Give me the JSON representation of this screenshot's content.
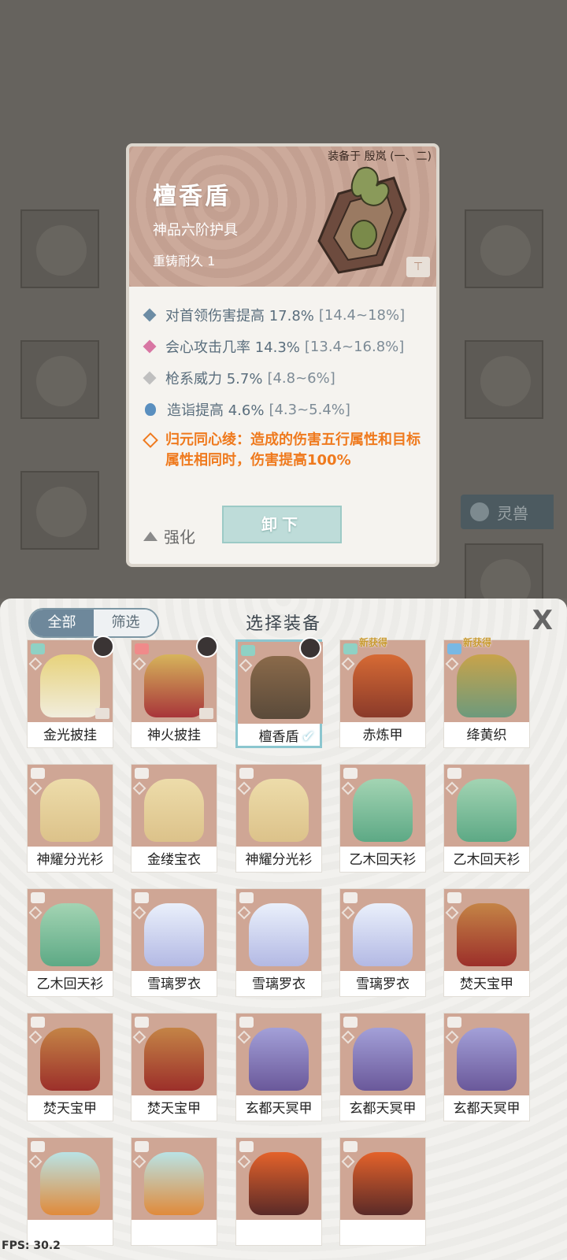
{
  "background": {
    "side_button_label": "灵兽"
  },
  "popup": {
    "equipped_by": "装备于 殷岚 (一、二)",
    "item_name": "檀香盾",
    "grade": "神品六阶护具",
    "reforge": "重铸耐久 1",
    "stats": [
      {
        "icon": "blue-diamond-icon",
        "text": "对首领伤害提高 17.8%",
        "range": "[14.4~18%]"
      },
      {
        "icon": "pink-diamond-icon",
        "text": "会心攻击几率 14.3%",
        "range": "[13.4~16.8%]"
      },
      {
        "icon": "grey-diamond-icon",
        "text": "枪系威力 5.7%",
        "range": "[4.8~6%]"
      },
      {
        "icon": "flame-icon",
        "text": "造诣提高 4.6%",
        "range": "[4.3~5.4%]"
      }
    ],
    "special_effect": "归元同心绫：造成的伤害五行属性和目标属性相同时，伤害提高100%",
    "unequip_label": "卸下",
    "enhance_label": "强化"
  },
  "sheet": {
    "filter_all": "全部",
    "filter_select": "筛选",
    "title": "选择装备",
    "close_symbol": "X",
    "new_tag": "新获得",
    "items": [
      {
        "name": "金光披挂",
        "art": "gold",
        "avatar": true,
        "badge": true
      },
      {
        "name": "神火披挂",
        "art": "red",
        "avatar": true,
        "badge": true
      },
      {
        "name": "檀香盾",
        "art": "brown",
        "avatar": true,
        "selected": true
      },
      {
        "name": "赤炼甲",
        "art": "fire",
        "new": true
      },
      {
        "name": "绛黄织",
        "art": "rainbow",
        "new": true
      },
      {
        "name": "神耀分光衫",
        "art": "cream"
      },
      {
        "name": "金缕宝衣",
        "art": "cream"
      },
      {
        "name": "神耀分光衫",
        "art": "cream"
      },
      {
        "name": "乙木回天衫",
        "art": "green"
      },
      {
        "name": "乙木回天衫",
        "art": "green"
      },
      {
        "name": "乙木回天衫",
        "art": "green"
      },
      {
        "name": "雪璃罗衣",
        "art": "ice"
      },
      {
        "name": "雪璃罗衣",
        "art": "ice"
      },
      {
        "name": "雪璃罗衣",
        "art": "ice"
      },
      {
        "name": "焚天宝甲",
        "art": "bronze"
      },
      {
        "name": "焚天宝甲",
        "art": "bronze"
      },
      {
        "name": "焚天宝甲",
        "art": "bronze"
      },
      {
        "name": "玄都天冥甲",
        "art": "purple"
      },
      {
        "name": "玄都天冥甲",
        "art": "purple"
      },
      {
        "name": "玄都天冥甲",
        "art": "purple"
      },
      {
        "name": "",
        "art": "cyan"
      },
      {
        "name": "",
        "art": "cyan"
      },
      {
        "name": "",
        "art": "lava"
      },
      {
        "name": "",
        "art": "lava"
      }
    ]
  },
  "fps": "FPS: 30.2"
}
